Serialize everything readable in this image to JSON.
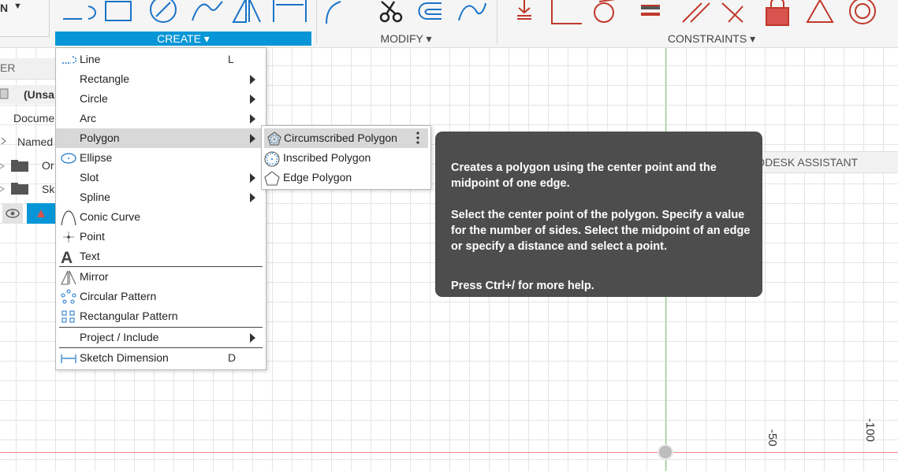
{
  "toolbar": {
    "workspace_label": "N",
    "groups": [
      {
        "label": "CREATE ▾",
        "active": true
      },
      {
        "label": "MODIFY ▾",
        "active": false
      },
      {
        "label": "CONSTRAINTS ▾",
        "active": false
      }
    ]
  },
  "browser": {
    "header": "ER",
    "root": "(Unsa",
    "items": [
      "Docume",
      "Named",
      "Or",
      "Sk"
    ]
  },
  "create_menu": {
    "items": [
      {
        "label": "Line",
        "shortcut": "L",
        "icon": "line-icon",
        "submenu": false
      },
      {
        "label": "Rectangle",
        "shortcut": "",
        "icon": "",
        "submenu": true
      },
      {
        "label": "Circle",
        "shortcut": "",
        "icon": "",
        "submenu": true
      },
      {
        "label": "Arc",
        "shortcut": "",
        "icon": "",
        "submenu": true
      },
      {
        "label": "Polygon",
        "shortcut": "",
        "icon": "",
        "submenu": true,
        "highlighted": true
      },
      {
        "label": "Ellipse",
        "shortcut": "",
        "icon": "ellipse-icon",
        "submenu": false
      },
      {
        "label": "Slot",
        "shortcut": "",
        "icon": "",
        "submenu": true
      },
      {
        "label": "Spline",
        "shortcut": "",
        "icon": "",
        "submenu": true
      },
      {
        "label": "Conic Curve",
        "shortcut": "",
        "icon": "conic-curve-icon",
        "submenu": false
      },
      {
        "label": "Point",
        "shortcut": "",
        "icon": "point-icon",
        "submenu": false
      },
      {
        "label": "Text",
        "shortcut": "",
        "icon": "text-icon",
        "submenu": false
      },
      {
        "label": "Mirror",
        "shortcut": "",
        "icon": "mirror-icon",
        "submenu": false
      },
      {
        "label": "Circular Pattern",
        "shortcut": "",
        "icon": "circular-pattern-icon",
        "submenu": false
      },
      {
        "label": "Rectangular Pattern",
        "shortcut": "",
        "icon": "rectangular-pattern-icon",
        "submenu": false
      },
      {
        "label": "Project / Include",
        "shortcut": "",
        "icon": "",
        "submenu": true
      },
      {
        "label": "Sketch Dimension",
        "shortcut": "D",
        "icon": "sketch-dimension-icon",
        "submenu": false
      }
    ]
  },
  "polygon_submenu": {
    "items": [
      {
        "label": "Circumscribed Polygon",
        "icon": "circumscribed-polygon-icon",
        "highlighted": true
      },
      {
        "label": "Inscribed Polygon",
        "icon": "inscribed-polygon-icon",
        "highlighted": false
      },
      {
        "label": "Edge Polygon",
        "icon": "edge-polygon-icon",
        "highlighted": false
      }
    ]
  },
  "tooltip": {
    "line1": "Creates a polygon using the center point and the midpoint of one edge.",
    "line2": "Select the center point of the polygon. Specify a value for the number of sides. Select the midpoint of an edge or specify a distance and select a point.",
    "line3": "Press Ctrl+/ for more help."
  },
  "assistant_tab": "DDESK ASSISTANT",
  "axis_labels": [
    "-50",
    "-100"
  ],
  "colors": {
    "accent": "#0696d7",
    "tooltip_bg": "#4d4d4d",
    "constraint_red": "#d9534f",
    "axis_green": "#7ed17e",
    "axis_red": "#e88888"
  }
}
